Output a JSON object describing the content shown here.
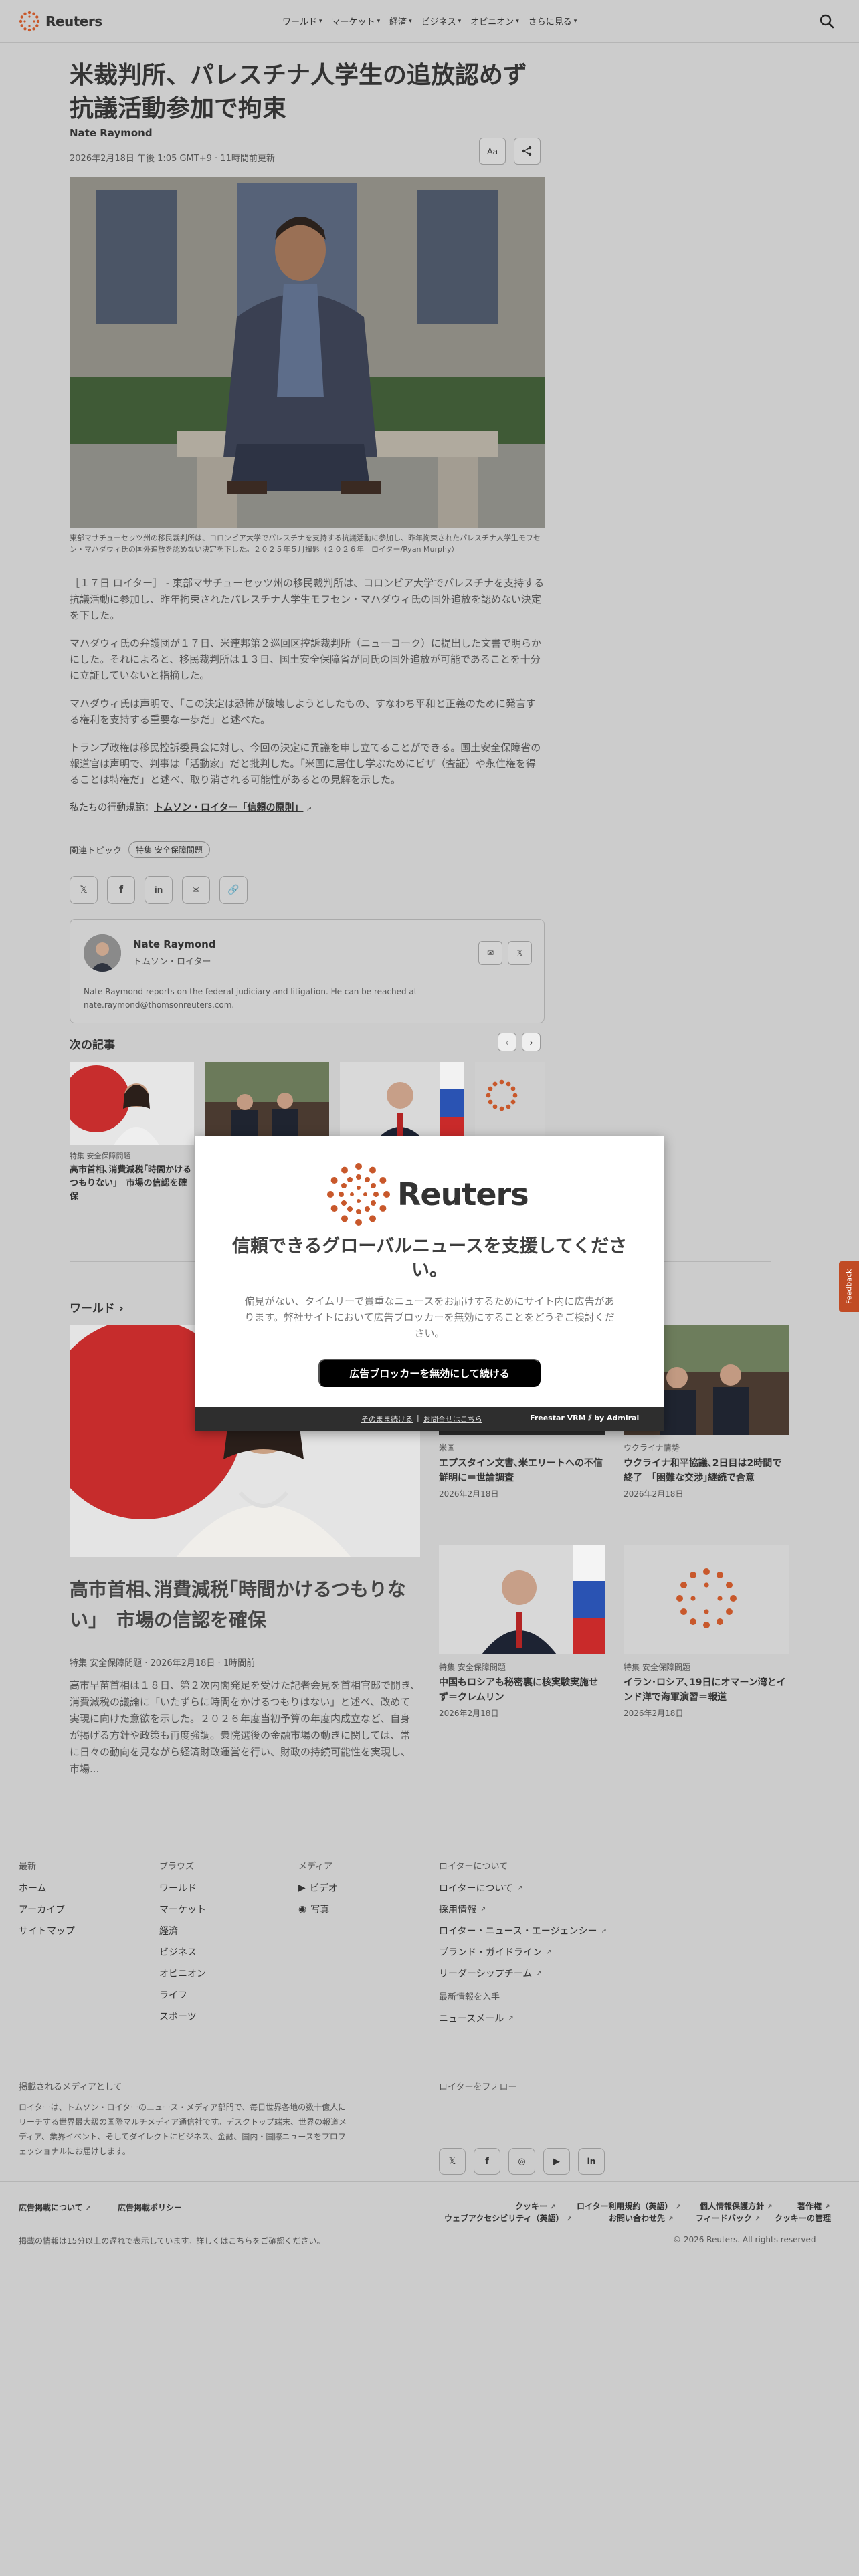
{
  "header": {
    "logo": "Reuters",
    "nav": [
      "ワールド",
      "マーケット",
      "経済",
      "ビジネス",
      "オピニオン",
      "さらに見る"
    ]
  },
  "article": {
    "headline": "米裁判所、パレスチナ人学生の追放認めず　抗議活動参加で拘束",
    "author": "Nate Raymond",
    "dateline": "2026年2月18日 午後 1:05 GMT+9 · 11時間前更新",
    "text_size_button": "Aa",
    "caption": "東部マサチューセッツ州の移民裁判所は、コロンビア大学でパレスチナを支持する抗議活動に参加し、昨年拘束されたパレスチナ人学生モフセン・マハダウィ氏の国外追放を認めない決定を下した。２０２５年５月撮影（２０２６年　ロイター/Ryan Murphy）",
    "paragraphs": [
      "［１７日 ロイター］ - 東部マサチューセッツ州の移民裁判所は、コロンビア大学でパレスチナを支持する抗議活動に参加し、昨年拘束されたパレスチナ人学生モフセン・マハダウィ氏の国外追放を認めない決定を下した。",
      "マハダウィ氏の弁護団が１７日、米連邦第２巡回区控訴裁判所（ニューヨーク）に提出した文書で明らかにした。それによると、移民裁判所は１３日、国土安全保障省が同氏の国外追放が可能であることを十分に立証していないと指摘した。",
      "マハダウィ氏は声明で、「この決定は恐怖が破壊しようとしたもの、すなわち平和と正義のために発言する権利を支持する重要な一歩だ」と述べた。",
      "トランプ政権は移民控訴委員会に対し、今回の決定に異議を申し立てることができる。国土安全保障省の報道官は声明で、判事は「活動家」だと批判した。「米国に居住し学ぶためにビザ（査証）や永住権を得ることは特権だ」と述べ、取り消される可能性があるとの見解を示した。"
    ],
    "trust_prefix": "私たちの行動規範：",
    "trust_link": "トムソン・ロイター「信頼の原則」",
    "topics_label": "関連トピック",
    "topic_chip": "特集 安全保障問題"
  },
  "author_card": {
    "name": "Nate Raymond",
    "role": "トムソン・ロイター",
    "bio": "Nate Raymond reports on the federal judiciary and litigation. He can be reached at nate.raymond@thomsonreuters.com."
  },
  "next_articles": {
    "title": "次の記事",
    "items": [
      {
        "kicker": "特集 安全保障問題",
        "headline": "高市首相､消費減税｢時間かけるつもりない｣　市場の信認を確保"
      },
      {
        "kicker": "",
        "headline": ""
      },
      {
        "kicker": "",
        "headline": ""
      },
      {
        "kicker": "",
        "headline": ""
      }
    ]
  },
  "world": {
    "title": "ワールド",
    "lead": {
      "headline": "高市首相､消費減税｢時間かけるつもりない｣　市場の信認を確保",
      "meta": "特集 安全保障問題 · 2026年2月18日 · 1時間前",
      "summary": "高市早苗首相は１８日、第２次内閣発足を受けた記者会見を首相官邸で開き、消費減税の議論に「いたずらに時間をかけるつもりはない」と述べ、改めて実現に向けた意欲を示した。２０２６年度当初予算の年度内成立など、自身が掲げる方針や政策も再度強調。衆院選後の金融市場の動きに関しては、常に日々の動向を見ながら経済財政運営を行い、財政の持続可能性を実現し、市場..."
    },
    "cards": [
      {
        "kicker": "米国",
        "headline": "エプスタイン文書､米エリートへの不信鮮明に＝世論調査",
        "date": "2026年2月18日"
      },
      {
        "kicker": "ウクライナ情勢",
        "headline": "ウクライナ和平協議､2日目は2時間で終了　｢困難な交渉｣継続で合意",
        "date": "2026年2月18日"
      },
      {
        "kicker": "特集 安全保障問題",
        "headline": "中国もロシアも秘密裏に核実験実施せず＝クレムリン",
        "date": "2026年2月18日"
      },
      {
        "kicker": "特集 安全保障問題",
        "headline": "イラン･ロシア､19日にオマーン湾とインド洋で海軍演習＝報道",
        "date": "2026年2月18日"
      }
    ]
  },
  "feedback": "Feedback",
  "modal": {
    "logo": "Reuters",
    "title": "信頼できるグローバルニュースを支援してください。",
    "text": "偏見がない、タイムリーで貴重なニュースをお届けするためにサイト内に広告があります。弊社サイトにおいて広告ブロッカーを無効にすることをどうぞご検討ください。",
    "cta": "広告ブロッカーを無効にして続ける",
    "link_continue": "そのまま続ける",
    "link_help": "お問合せはこちら",
    "brand": "Freestar VRM ⫽ by Admiral"
  },
  "footer": {
    "col1": {
      "title": "最新",
      "items": [
        "ホーム",
        "アーカイブ",
        "サイトマップ"
      ]
    },
    "col2": {
      "title": "ブラウズ",
      "items": [
        "ワールド",
        "マーケット",
        "経済",
        "ビジネス",
        "オピニオン",
        "ライフ",
        "スポーツ"
      ]
    },
    "col3": {
      "title": "メディア",
      "items": [
        "ビデオ",
        "写真"
      ]
    },
    "col4": {
      "title": "ロイターについて",
      "items": [
        "ロイターについて",
        "採用情報",
        "ロイター・ニュース・エージェンシー",
        "ブランド・ガイドライン",
        "リーダーシップチーム"
      ]
    },
    "newsletter_title": "最新情報を入手",
    "newsletter_item": "ニュースメール",
    "media_title": "掲載されるメディアとして",
    "media_text": "ロイターは、トムソン・ロイターのニュース・メディア部門で、毎日世界各地の数十億人にリーチする世界最大級の国際マルチメディア通信社です。デスクトップ端末、世界の報道メディア、業界イベント、そしてダイレクトにビジネス、金融、国内・国際ニュースをプロフェッショナルにお届けします。",
    "follow_title": "ロイターをフォロー",
    "social": [
      "𝕏",
      "f",
      "◎",
      "▶",
      "in"
    ],
    "legal_left": [
      "広告掲載について",
      "広告掲載ポリシー"
    ],
    "legal_right_row1": [
      "クッキー",
      "ロイター利用規約（英語）",
      "個人情報保護方針",
      "著作権"
    ],
    "legal_right_row2": [
      "ウェブアクセシビリティ（英語）",
      "お問い合わせ先",
      "フィードバック",
      "クッキーの管理"
    ],
    "delay_notice": "掲載の情報は15分以上の遅れで表示しています。詳しくはこちらをご確認ください。",
    "copyright": "© 2026 Reuters. All rights reserved"
  }
}
